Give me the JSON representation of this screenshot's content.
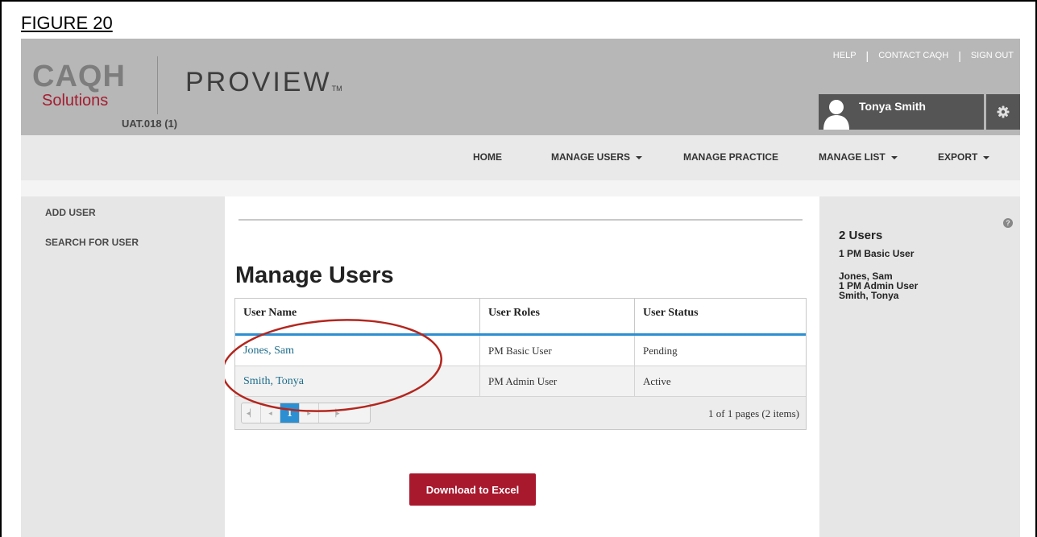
{
  "figure": {
    "label": "FIGURE 20"
  },
  "header": {
    "logo_top": "CAQH",
    "logo_bottom": "Solutions",
    "product": "PROVIEW",
    "product_tm": "TM",
    "org_id": "UAT.018 (1)",
    "top_links": [
      "HELP",
      "CONTACT CAQH",
      "SIGN OUT"
    ],
    "user_name": "Tonya Smith"
  },
  "nav": {
    "items": [
      {
        "label": "HOME",
        "dropdown": false
      },
      {
        "label": "MANAGE USERS",
        "dropdown": true
      },
      {
        "label": "MANAGE PRACTICE",
        "dropdown": false
      },
      {
        "label": "MANAGE LIST",
        "dropdown": true
      },
      {
        "label": "EXPORT",
        "dropdown": true
      }
    ]
  },
  "sidebar": {
    "items": [
      {
        "label": "ADD USER"
      },
      {
        "label": "SEARCH FOR USER"
      }
    ]
  },
  "main": {
    "title": "Manage Users",
    "table": {
      "columns": [
        "User Name",
        "User Roles",
        "User Status"
      ],
      "rows": [
        [
          "Jones, Sam",
          "PM Basic User",
          "Pending"
        ],
        [
          "Smith, Tonya",
          "PM Admin User",
          "Active"
        ]
      ]
    },
    "pager": {
      "current_page": "1",
      "info": "1 of 1 pages (2 items)"
    },
    "download_label": "Download to Excel"
  },
  "summary": {
    "count": "2 Users",
    "lines": [
      "1  PM Basic User",
      "Jones, Sam",
      "1  PM Admin User",
      "Smith, Tonya"
    ]
  },
  "colors": {
    "header_bg": "#b7b7b7",
    "brand_red": "#a8192e",
    "accent_blue": "#2b8fd1",
    "link": "#1d6d8c",
    "annotation": "#b3261e"
  },
  "icons": [
    "user-avatar-icon",
    "gear-icon",
    "first-page-icon",
    "prev-page-icon",
    "next-page-icon",
    "last-page-icon",
    "help-icon"
  ]
}
